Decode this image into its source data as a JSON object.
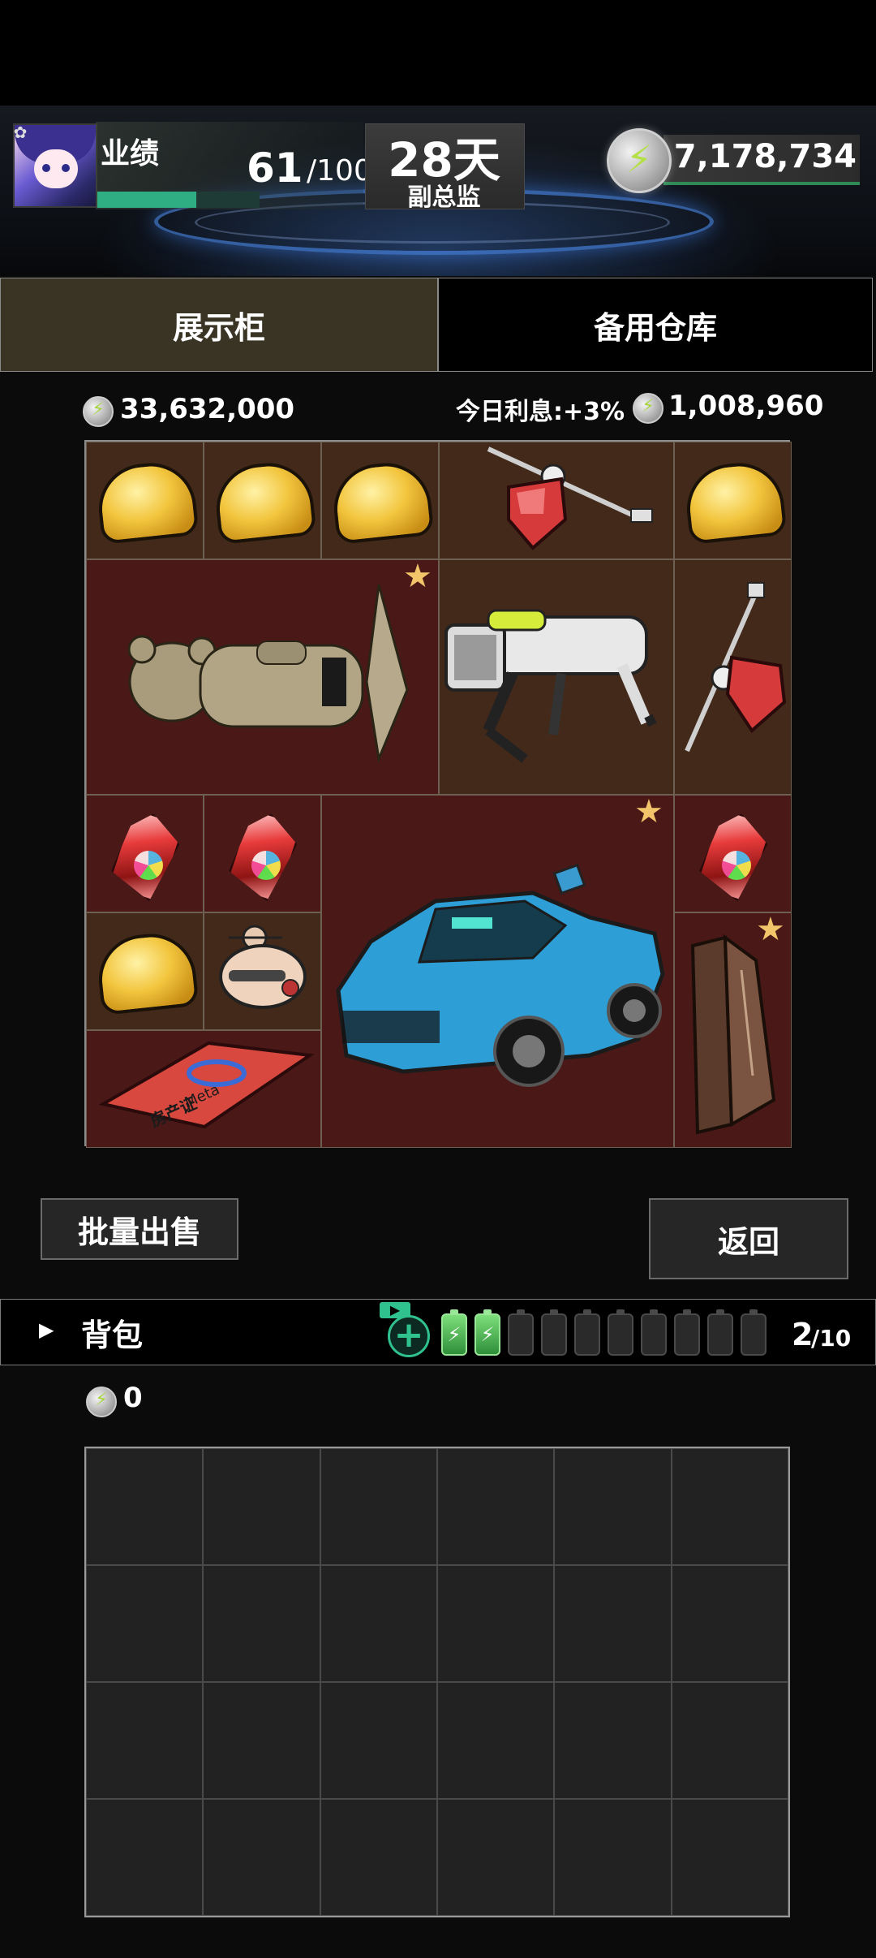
{
  "header": {
    "performance_label": "业绩",
    "performance_value": "61",
    "performance_max": "/100",
    "performance_progress": 0.61,
    "days": "28天",
    "rank": "副总监",
    "money": "7,178,734"
  },
  "tabs": [
    {
      "label": "展示柜",
      "active": true
    },
    {
      "label": "备用仓库",
      "active": false
    }
  ],
  "showcase": {
    "total_value": "33,632,000",
    "interest_label": "今日利息:+3% =",
    "interest_value": "1,008,960",
    "items": [
      {
        "name": "gold-ingot"
      },
      {
        "name": "gold-ingot"
      },
      {
        "name": "gold-ingot"
      },
      {
        "name": "red-lantern-tool"
      },
      {
        "name": "gold-ingot"
      },
      {
        "name": "stone-statue"
      },
      {
        "name": "robot-dog"
      },
      {
        "name": "red-lantern-tool"
      },
      {
        "name": "ruby-crystal"
      },
      {
        "name": "ruby-crystal"
      },
      {
        "name": "sports-car"
      },
      {
        "name": "ruby-crystal"
      },
      {
        "name": "gold-ingot"
      },
      {
        "name": "robot-head"
      },
      {
        "name": "wooden-planks"
      },
      {
        "name": "property-certificate"
      }
    ],
    "certificate_text": "房产证",
    "certificate_logo": "Meta"
  },
  "buttons": {
    "batch_sell": "批量出售",
    "back": "返回"
  },
  "backpack": {
    "label": "背包",
    "capacity": "2",
    "capacity_max": "/10",
    "batteries_full": 2,
    "batteries_total": 10,
    "value": "0"
  },
  "colors": {
    "accent_green": "#2fae84",
    "tab_active": "#3a3425",
    "cell_brown": "#43291a",
    "cell_red": "#4b1818",
    "star": "#f3c56a"
  }
}
